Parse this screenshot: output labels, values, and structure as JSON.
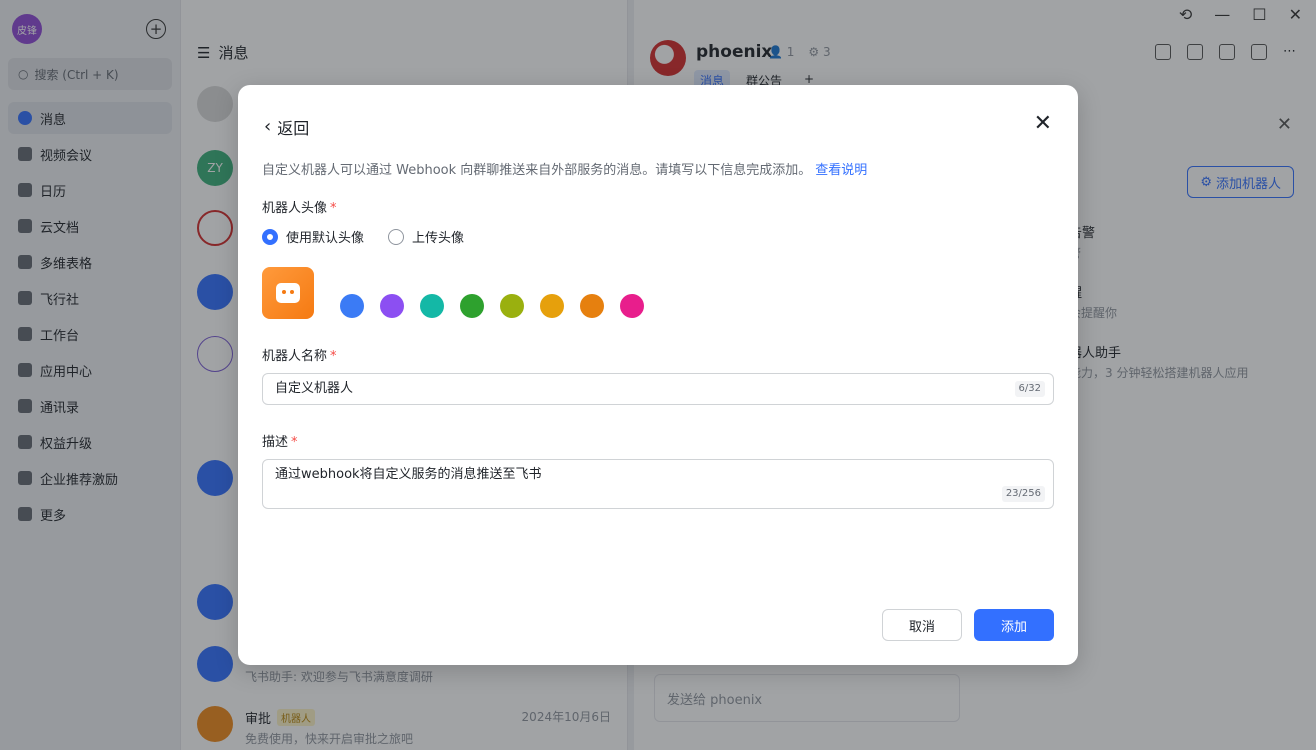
{
  "sidebar": {
    "avatar_text": "皮锋",
    "search_placeholder": "搜索 (Ctrl + K)",
    "items": [
      {
        "label": "消息"
      },
      {
        "label": "视频会议"
      },
      {
        "label": "日历"
      },
      {
        "label": "云文档"
      },
      {
        "label": "多维表格"
      },
      {
        "label": "飞行社"
      },
      {
        "label": "工作台"
      },
      {
        "label": "应用中心"
      },
      {
        "label": "通讯录"
      },
      {
        "label": "权益升级"
      },
      {
        "label": "企业推荐激励"
      },
      {
        "label": "更多"
      }
    ]
  },
  "chatlist": {
    "title": "消息",
    "zy_avatar": "ZY",
    "row_bot_preview": "飞书助手: 欢迎参与飞书满意度调研",
    "row_approval_name": "审批",
    "row_approval_tag": "机器人",
    "row_approval_date": "2024年10月6日",
    "row_approval_preview": "免费使用，快来开启审批之旅吧"
  },
  "conversation": {
    "title": "phoenix",
    "members": "1",
    "bots": "3",
    "tab_messages": "消息",
    "tab_notice": "群公告",
    "tab_add": "+",
    "send_placeholder": "发送给 phoenix",
    "panel_add_robot": "添加机器人",
    "panel_line1": "告警",
    "panel_sub1": "警",
    "panel_line2": "醒",
    "panel_sub2": "会提醒你",
    "panel_line3": "器人助手",
    "panel_sub3": "能力，3 分钟轻松搭建机器人应用"
  },
  "modal": {
    "back_label": "返回",
    "intro": "自定义机器人可以通过 Webhook 向群聊推送来自外部服务的消息。请填写以下信息完成添加。",
    "intro_link": "查看说明",
    "avatar_label": "机器人头像",
    "radio_default": "使用默认头像",
    "radio_upload": "上传头像",
    "colors": [
      "#3b7bf5",
      "#8c4ff2",
      "#14b8a6",
      "#2ea12e",
      "#9ab00f",
      "#e6a00c",
      "#e6800f",
      "#e81e8c"
    ],
    "name_label": "机器人名称",
    "name_value": "自定义机器人",
    "name_counter": "6/32",
    "desc_label": "描述",
    "desc_value": "通过webhook将自定义服务的消息推送至飞书",
    "desc_counter": "23/256",
    "required_mark": "*",
    "cancel_label": "取消",
    "add_label": "添加"
  }
}
